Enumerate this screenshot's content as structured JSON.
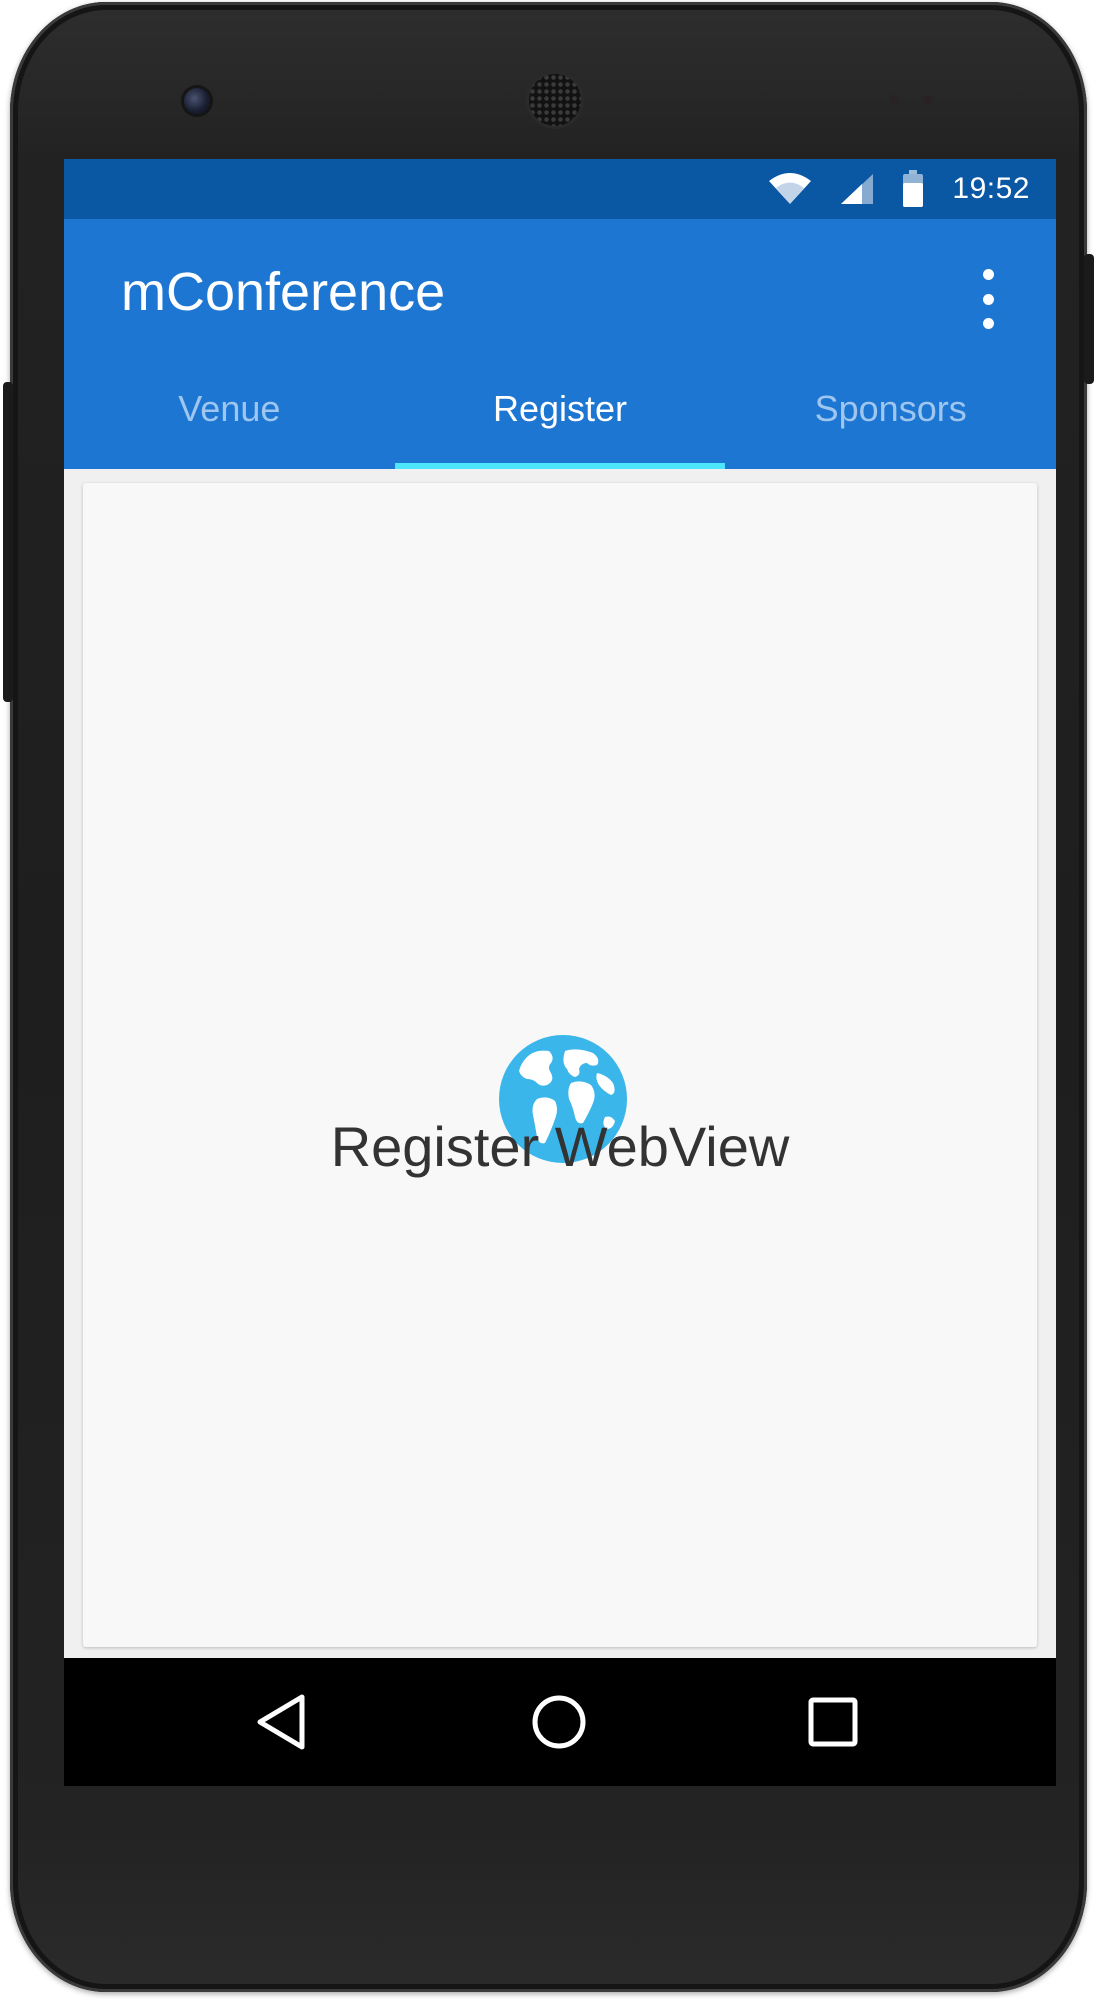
{
  "status_bar": {
    "time": "19:52",
    "icons": [
      "wifi-icon",
      "cell-signal-icon",
      "battery-icon"
    ]
  },
  "app_bar": {
    "title": "mConference",
    "overflow_icon": "more-vert-icon",
    "color": "#1d76d2"
  },
  "tabs": [
    {
      "label": "Venue",
      "active": false
    },
    {
      "label": "Register",
      "active": true
    },
    {
      "label": "Sponsors",
      "active": false
    }
  ],
  "content": {
    "icon": "globe-icon",
    "label": "Register WebView",
    "icon_color": "#3ab6ea"
  },
  "nav_bar": {
    "icons": [
      "back-icon",
      "home-icon",
      "recents-icon"
    ]
  },
  "colors": {
    "status_bar": "#0a57a3",
    "tab_indicator": "#4ee6ff",
    "inactive_tab": "#9fc6ef"
  }
}
